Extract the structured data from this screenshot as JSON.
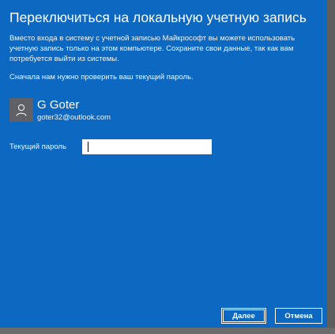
{
  "dialog": {
    "title": "Переключиться на локальную учетную запись",
    "description": "Вместо входа в систему с учетной записью Майкрософт вы можете использовать учетную запись только на этом компьютере. Сохраните свои данные, так как вам потребуется выйти из системы.",
    "verify_text": "Сначала нам нужно проверить ваш текущий пароль."
  },
  "user": {
    "avatar_icon": "user-icon",
    "name": "G Goter",
    "email": "goter32@outlook.com"
  },
  "password": {
    "label": "Текущий пароль",
    "value": ""
  },
  "buttons": {
    "next": "Далее",
    "cancel": "Отмена"
  },
  "colors": {
    "dialog_background": "#0d68c2",
    "avatar_background": "#5f6166",
    "text": "#ffffff"
  }
}
